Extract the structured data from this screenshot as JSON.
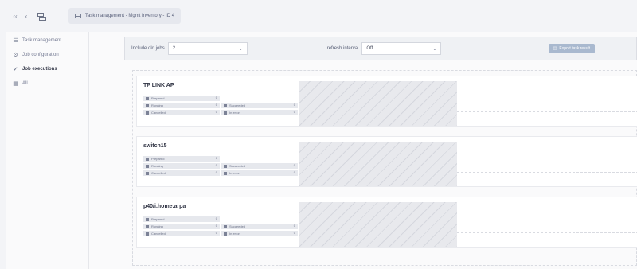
{
  "toolbar": {
    "back_icon": "chevron-left-icon",
    "forward_icon": "chevron-left-icon",
    "tree_icon": "tree-icon"
  },
  "tab": {
    "icon": "list-icon",
    "label": "Task management - Mgmt Inventory - ID 4"
  },
  "sidebar": {
    "items": [
      {
        "label": "Task management",
        "icon": "list-icon",
        "active": false
      },
      {
        "label": "Job configuration",
        "icon": "gear-icon",
        "active": false
      },
      {
        "label": "Job executions",
        "icon": "check-icon",
        "active": true
      },
      {
        "label": "All",
        "icon": "grid-icon",
        "active": false
      }
    ]
  },
  "filters": {
    "include_old_jobs_label": "Include old jobs",
    "include_old_jobs_value": "2",
    "refresh_interval_label": "refresh interval",
    "refresh_interval_value": "Off",
    "export_label": "Export task result"
  },
  "stat_labels": {
    "prepared": "Prepared",
    "running": "Running",
    "cancelled": "Cancelled",
    "succeeded": "Succeeded",
    "in_error": "In error"
  },
  "cards": [
    {
      "title": "TP LINK AP",
      "prepared": "0",
      "running": "0",
      "cancelled": "0",
      "succeeded": "0",
      "in_error": "0"
    },
    {
      "title": "switch15",
      "prepared": "0",
      "running": "0",
      "cancelled": "0",
      "succeeded": "0",
      "in_error": "0"
    },
    {
      "title": "p40/i.home.arpa",
      "prepared": "0",
      "running": "0",
      "cancelled": "0",
      "succeeded": "0",
      "in_error": "0"
    }
  ],
  "colors": {
    "export_button": "#a9b9cf",
    "page_background": "#f3f4f7",
    "hatch_background": "#e8e9ed"
  }
}
